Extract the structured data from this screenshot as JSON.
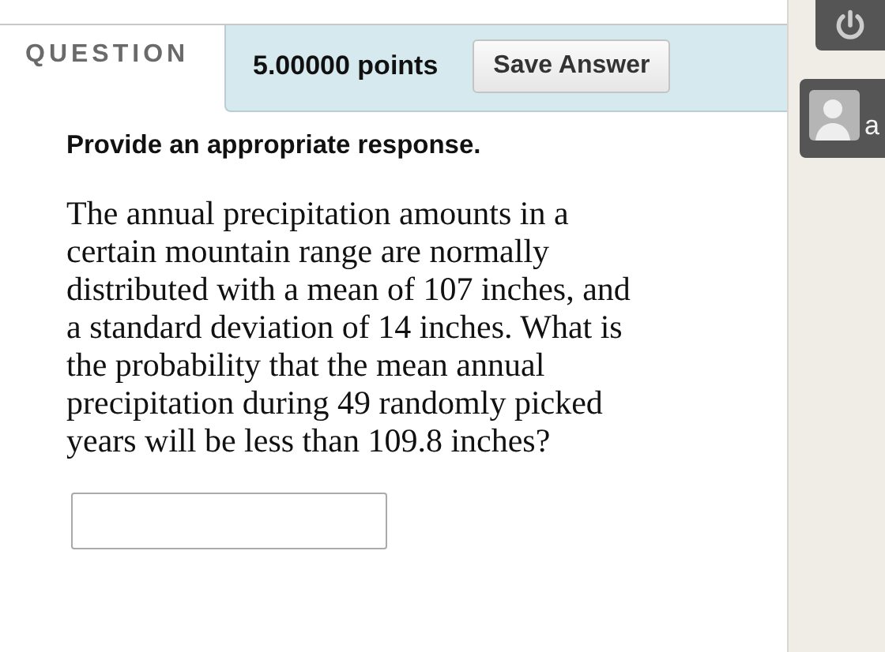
{
  "question": {
    "label": "QUESTION",
    "points": "5.00000 points",
    "save_button": "Save Answer",
    "instruction": "Provide an appropriate response.",
    "text": "The annual precipitation amounts in a certain mountain range are normally distributed with a mean of 107 inches, and a standard deviation of 14 inches. What is the probability that the mean annual precipitation during 49 randomly picked years will be less than 109.8 inches?"
  },
  "sidebar": {
    "user_name": "a"
  }
}
